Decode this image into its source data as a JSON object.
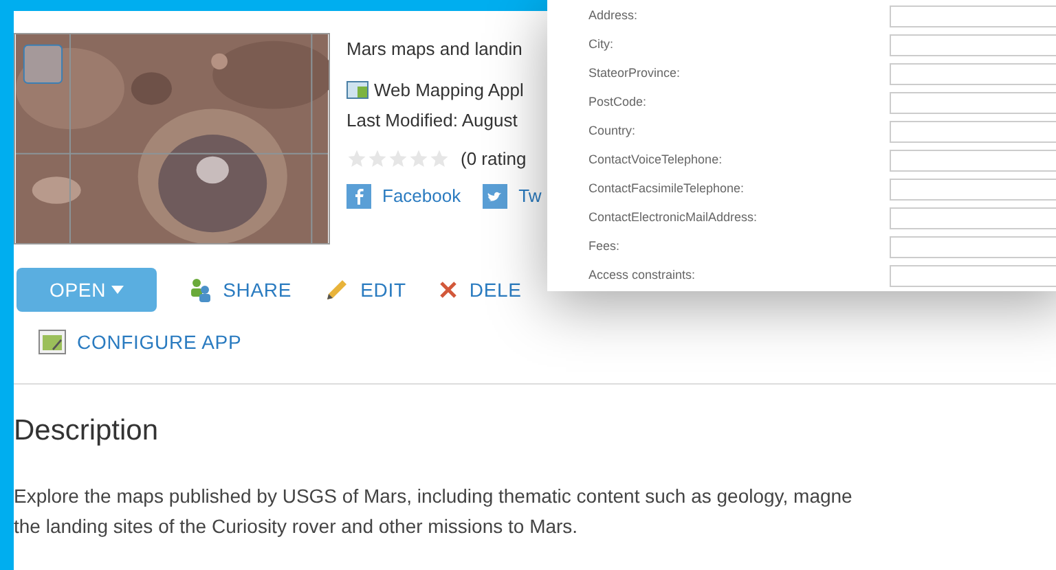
{
  "item": {
    "title": "Mars maps and landin",
    "type": "Web Mapping Appl",
    "modified": "Last Modified: August",
    "stars": 0,
    "ratings": "(0 rating",
    "share_links": [
      {
        "kind": "facebook",
        "label": "Facebook"
      },
      {
        "kind": "twitter",
        "label": "Tw"
      }
    ]
  },
  "actions": [
    {
      "kind": "open",
      "label": "OPEN"
    },
    {
      "kind": "share",
      "label": "SHARE"
    },
    {
      "kind": "edit",
      "label": "EDIT"
    },
    {
      "kind": "delete",
      "label": "DELE"
    },
    {
      "kind": "configure",
      "label": "CONFIGURE APP"
    }
  ],
  "description": {
    "heading": "Description",
    "text": "Explore the maps published by USGS of Mars, including thematic content such as geology, magne",
    "text_2": "the landing sites of the Curiosity rover and other missions to Mars."
  },
  "dialog": {
    "fields": [
      {
        "label": "Address:"
      },
      {
        "label": "City:"
      },
      {
        "label": "StateorProvince:"
      },
      {
        "label": "PostCode:"
      },
      {
        "label": "Country:"
      },
      {
        "label": "ContactVoiceTelephone:"
      },
      {
        "label": "ContactFacsimileTelephone:"
      },
      {
        "label": "ContactElectronicMailAddress:"
      },
      {
        "label": "Fees:"
      },
      {
        "label": "Access constraints:"
      }
    ]
  }
}
